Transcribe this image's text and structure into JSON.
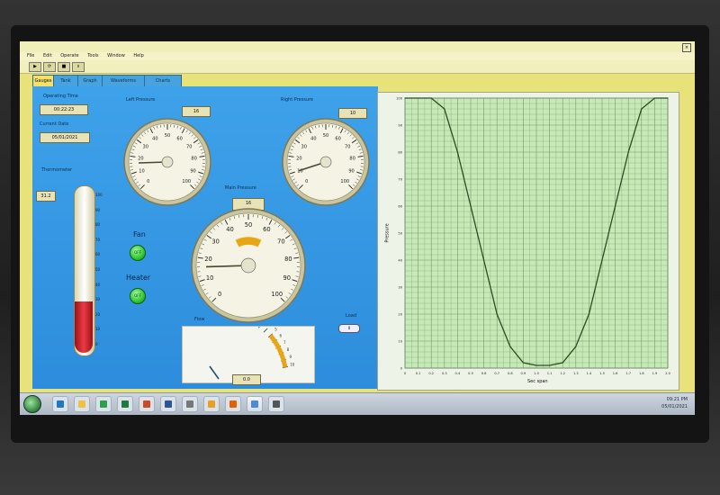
{
  "window": {
    "app_title": "",
    "menu": [
      "File",
      "Edit",
      "Operate",
      "Tools",
      "Window",
      "Help"
    ]
  },
  "tabs": [
    "Gauges",
    "Tank",
    "Graph",
    "Waveforms",
    "Charts"
  ],
  "operating_time": {
    "label": "Operating Time",
    "value": "00:22:23"
  },
  "current_date": {
    "label": "Current Date",
    "value": "05/01/2021"
  },
  "thermometer": {
    "label": "Thermometer",
    "value": "31.2",
    "scale": [
      "100",
      "90",
      "80",
      "70",
      "60",
      "50",
      "40",
      "30",
      "20",
      "10",
      "0"
    ],
    "fill_fraction": 0.32
  },
  "left_pressure": {
    "label": "Left Pressure",
    "value": "16",
    "ticks": [
      "0",
      "10",
      "20",
      "30",
      "40",
      "50",
      "60",
      "70",
      "80",
      "90",
      "100"
    ],
    "needle_value": 16
  },
  "right_pressure": {
    "label": "Right Pressure",
    "value": "10",
    "ticks": [
      "0",
      "10",
      "20",
      "30",
      "40",
      "50",
      "60",
      "70",
      "80",
      "90",
      "100"
    ],
    "needle_value": 10
  },
  "main_pressure": {
    "label": "Main Pressure",
    "value": "16",
    "ticks": [
      "0",
      "10",
      "20",
      "30",
      "40",
      "50",
      "60",
      "70",
      "80",
      "90",
      "100"
    ],
    "needle_value": 16
  },
  "fan": {
    "label": "Fan",
    "state": "OFF"
  },
  "heater": {
    "label": "Heater",
    "state": "OFF"
  },
  "flow": {
    "label": "Flow",
    "value": "0.0",
    "ticks": [
      "0",
      "1",
      "2",
      "3",
      "4",
      "5",
      "6",
      "7",
      "8",
      "9",
      "10"
    ]
  },
  "load": {
    "label": "Load",
    "value": "0"
  },
  "chart_data": {
    "type": "line",
    "title": "",
    "xlabel": "Sec span",
    "ylabel": "Pressure",
    "xlim": [
      0,
      2.0
    ],
    "ylim": [
      0,
      100
    ],
    "grid": true,
    "x": [
      0.0,
      0.1,
      0.2,
      0.3,
      0.4,
      0.5,
      0.6,
      0.7,
      0.8,
      0.9,
      1.0,
      1.1,
      1.2,
      1.3,
      1.4,
      1.5,
      1.6,
      1.7,
      1.8,
      1.9,
      2.0
    ],
    "y": [
      100,
      100,
      100,
      96,
      80,
      60,
      40,
      20,
      8,
      2,
      1,
      1,
      2,
      8,
      20,
      40,
      60,
      80,
      96,
      100,
      100
    ],
    "x_ticks": [
      "0",
      "0.1",
      "0.2",
      "0.3",
      "0.4",
      "0.5",
      "0.6",
      "0.7",
      "0.8",
      "0.9",
      "1.0",
      "1.1",
      "1.2",
      "1.3",
      "1.4",
      "1.5",
      "1.6",
      "1.7",
      "1.8",
      "1.9",
      "2.0"
    ],
    "y_ticks": [
      "0",
      "10",
      "20",
      "30",
      "40",
      "50",
      "60",
      "70",
      "80",
      "90",
      "100"
    ]
  },
  "taskbar": {
    "items": [
      "windows-start",
      "internet-explorer",
      "file-explorer",
      "media-player",
      "excel",
      "powerpoint",
      "word",
      "settings",
      "chrome",
      "firefox",
      "labview",
      "terminal"
    ],
    "tray_time": "09:21 PM",
    "tray_date": "05/01/2021"
  },
  "colors": {
    "panel": "#2d8ddc",
    "chart_line": "#2d4d25",
    "thermo_fill": "#e0202b",
    "gauge_arc": "#e8a617"
  }
}
